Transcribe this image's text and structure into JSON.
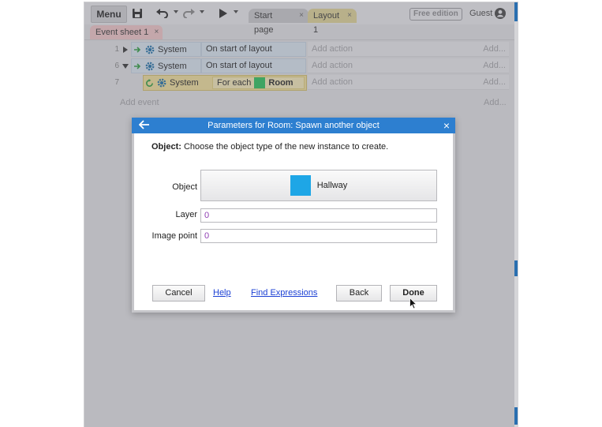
{
  "toolbar": {
    "menu_label": "Menu",
    "tabs": [
      {
        "label": "Start page",
        "close": "×"
      },
      {
        "label": "Layout 1",
        "close": "×"
      }
    ],
    "free_edition": "Free edition",
    "guest": "Guest"
  },
  "sheet_tab": {
    "label": "Event sheet 1",
    "close": "×"
  },
  "events": [
    {
      "number": "1",
      "object": "System",
      "condition": "On start of layout",
      "action_placeholder": "Add action",
      "add": "Add..."
    },
    {
      "number": "6",
      "object": "System",
      "condition": "On start of layout",
      "action_placeholder": "Add action",
      "add": "Add..."
    },
    {
      "number": "7",
      "object": "System",
      "condition_prefix": "For each",
      "condition_object": "Room",
      "action_placeholder": "Add action",
      "add": "Add..."
    }
  ],
  "add_event": {
    "label": "Add event",
    "add": "Add..."
  },
  "dialog": {
    "title": "Parameters for Room: Spawn another object",
    "close": "×",
    "description_label": "Object:",
    "description_text": " Choose the object type of the new instance to create.",
    "params": {
      "object": {
        "label": "Object",
        "value": "Hallway"
      },
      "layer": {
        "label": "Layer",
        "value": "0"
      },
      "image_point": {
        "label": "Image point",
        "value": "0"
      }
    },
    "buttons": {
      "cancel": "Cancel",
      "help": "Help",
      "find_expressions": "Find Expressions",
      "back": "Back",
      "done": "Done"
    }
  },
  "colors": {
    "accent": "#2d7fd0",
    "room_color": "#27c25a",
    "hallway_color": "#1ea6e6",
    "expression_text": "#8f3fb3",
    "link": "#1a3fd4"
  },
  "icons": {
    "save": "save-icon",
    "undo": "undo-icon",
    "redo": "redo-icon",
    "play": "play-icon",
    "avatar": "user-avatar-icon",
    "system": "gear-icon",
    "condition_arrow": "green-arrow-icon",
    "loop": "loop-icon",
    "back": "back-arrow-icon"
  }
}
